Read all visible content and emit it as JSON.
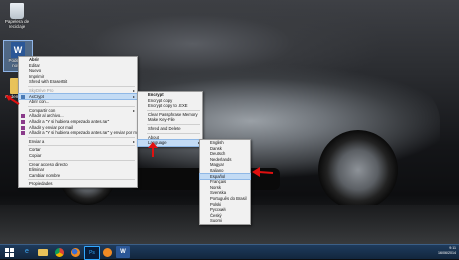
{
  "desktop_icons": [
    {
      "label": "Papelera de reciclaje"
    },
    {
      "label": "Podemos nos…"
    },
    {
      "label": "Podemos…"
    }
  ],
  "context_menu": {
    "items": [
      {
        "label": "Abrir",
        "bold": true
      },
      {
        "label": "Editar"
      },
      {
        "label": "Nuevo"
      },
      {
        "label": "Imprimir"
      },
      {
        "label": "Shred with EraserBit"
      },
      {
        "label": "SkyDrive Pro",
        "disabled": true,
        "submenu": true
      },
      {
        "label": "AxCrypt",
        "submenu": true,
        "highlighted": true
      },
      {
        "label": "Abrir con..."
      },
      {
        "label": "Compartir con",
        "submenu": true
      },
      {
        "label": "Añadir al archivo..."
      },
      {
        "label": "Añadir a \"Y si hubiera empezado antes.rar\""
      },
      {
        "label": "Añadir y enviar por mail"
      },
      {
        "label": "Añadir a \"Y si hubiera empezado antes.rar\" y enviar por mail"
      },
      {
        "label": "Enviar a",
        "submenu": true
      },
      {
        "label": "Cortar"
      },
      {
        "label": "Copiar"
      },
      {
        "label": "Crear acceso directo"
      },
      {
        "label": "Eliminar"
      },
      {
        "label": "Cambiar nombre"
      },
      {
        "label": "Propiedades"
      }
    ]
  },
  "axcrypt_menu": {
    "items": [
      {
        "label": "Encrypt",
        "bold": true
      },
      {
        "label": "Encrypt copy"
      },
      {
        "label": "Encrypt copy to .EXE"
      },
      {
        "label": "Clear Passphrase Memory"
      },
      {
        "label": "Make Key-File"
      },
      {
        "label": "Shred and Delete"
      },
      {
        "label": "About"
      },
      {
        "label": "Language",
        "submenu": true,
        "highlighted": true
      }
    ]
  },
  "language_menu": {
    "items": [
      {
        "label": "English"
      },
      {
        "label": "Dansk"
      },
      {
        "label": "Deutsch"
      },
      {
        "label": "Nederlands"
      },
      {
        "label": "Magyar"
      },
      {
        "label": "Italiano"
      },
      {
        "label": "Español",
        "highlighted": true
      },
      {
        "label": "Français"
      },
      {
        "label": "Norsk"
      },
      {
        "label": "Svenska"
      },
      {
        "label": "Português do Brasil"
      },
      {
        "label": "Polski"
      },
      {
        "label": "Русский"
      },
      {
        "label": "Český"
      },
      {
        "label": "Suomi"
      }
    ]
  },
  "taskbar": {
    "buttons": [
      {
        "icon": "windows-start-icon"
      },
      {
        "icon": "internet-explorer-icon"
      },
      {
        "icon": "file-explorer-icon"
      },
      {
        "icon": "chrome-icon"
      },
      {
        "icon": "firefox-icon"
      },
      {
        "icon": "photoshop-icon"
      },
      {
        "icon": "media-player-icon"
      },
      {
        "icon": "word-icon"
      }
    ],
    "clock_time": "9:11",
    "clock_date": "16/06/2014"
  },
  "colors": {
    "accent_red": "#e01010",
    "menu_highlight": "#c3dbf4",
    "taskbar": "#1a3552"
  }
}
